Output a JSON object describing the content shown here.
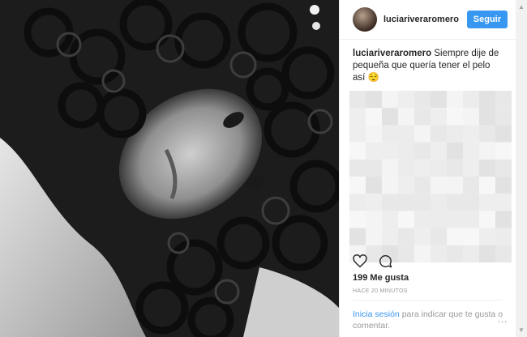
{
  "post": {
    "username": "luciariveraromero",
    "follow_label": "Seguir",
    "caption_user": "luciariveraromero",
    "caption_text": " Siempre dije de pequeña que quería tener el pelo así 😌",
    "likes": "199 Me gusta",
    "timestamp": "HACE 20 MINUTOS",
    "login_link": "Inicia sesión",
    "login_text": " para indicar que te gusta o comentar.",
    "more_options_icon": "…"
  },
  "icons": [
    "heart-icon",
    "comment-icon",
    "more-options-icon"
  ],
  "colors": {
    "accent": "#3897f0",
    "text": "#262626",
    "muted": "#999999"
  }
}
